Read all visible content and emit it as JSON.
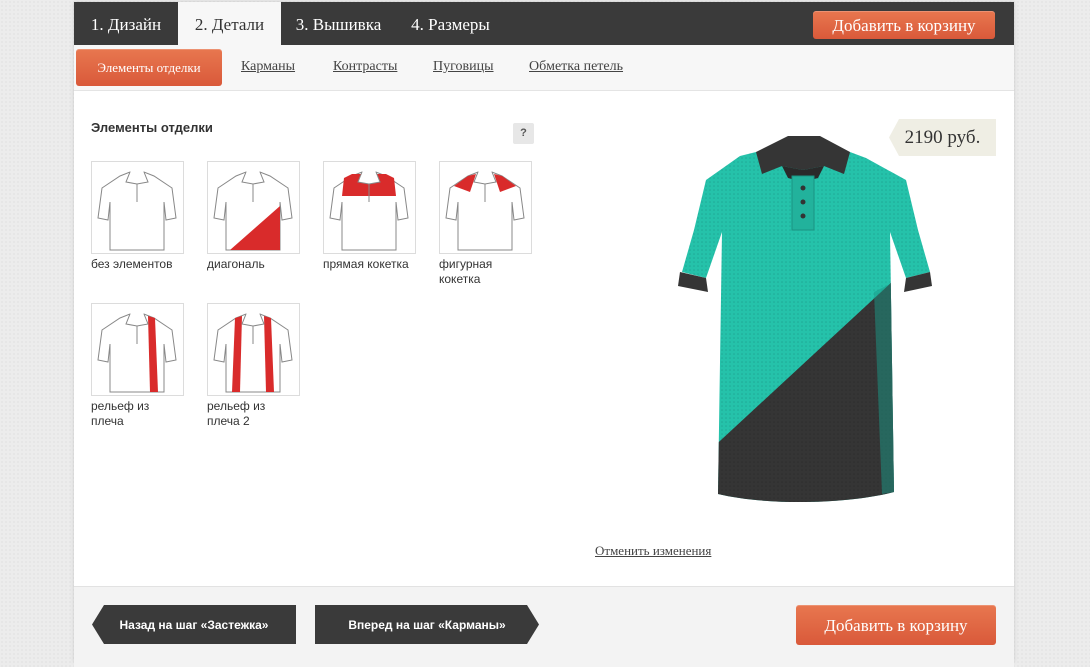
{
  "tabs": [
    {
      "label": "1. Дизайн"
    },
    {
      "label": "2. Детали"
    },
    {
      "label": "3. Вышивка"
    },
    {
      "label": "4. Размеры"
    }
  ],
  "header": {
    "cart_label": "Добавить в корзину"
  },
  "subtabs": [
    {
      "label": "Элементы отделки"
    },
    {
      "label": "Карманы"
    },
    {
      "label": "Контрасты"
    },
    {
      "label": "Пуговицы"
    },
    {
      "label": "Обметка петель"
    }
  ],
  "section": {
    "title": "Элементы отделки",
    "help": "?"
  },
  "options": [
    {
      "label": "без элементов",
      "icon": "plain-shirt-icon"
    },
    {
      "label": "диагональ",
      "icon": "diagonal-shirt-icon"
    },
    {
      "label": "прямая кокетка",
      "icon": "straight-yoke-shirt-icon"
    },
    {
      "label": "фигурная кокетка",
      "icon": "shaped-yoke-shirt-icon"
    },
    {
      "label": "рельеф из плеча",
      "icon": "shoulder-relief-shirt-icon"
    },
    {
      "label": "рельеф из плеча 2",
      "icon": "shoulder-relief-2-shirt-icon"
    }
  ],
  "preview": {
    "price": "2190 руб.",
    "cancel_label": "Отменить изменения"
  },
  "footer": {
    "back_label": "Назад на шаг «Застежка»",
    "forward_label": "Вперед на шаг «Карманы»",
    "cart_label": "Добавить в корзину"
  },
  "colors": {
    "accent": "#dd6442",
    "dark": "#3a3a3a",
    "shirt_main": "#25c2aa",
    "shirt_trim": "#353535",
    "thumb_accent": "#d92b2b"
  }
}
